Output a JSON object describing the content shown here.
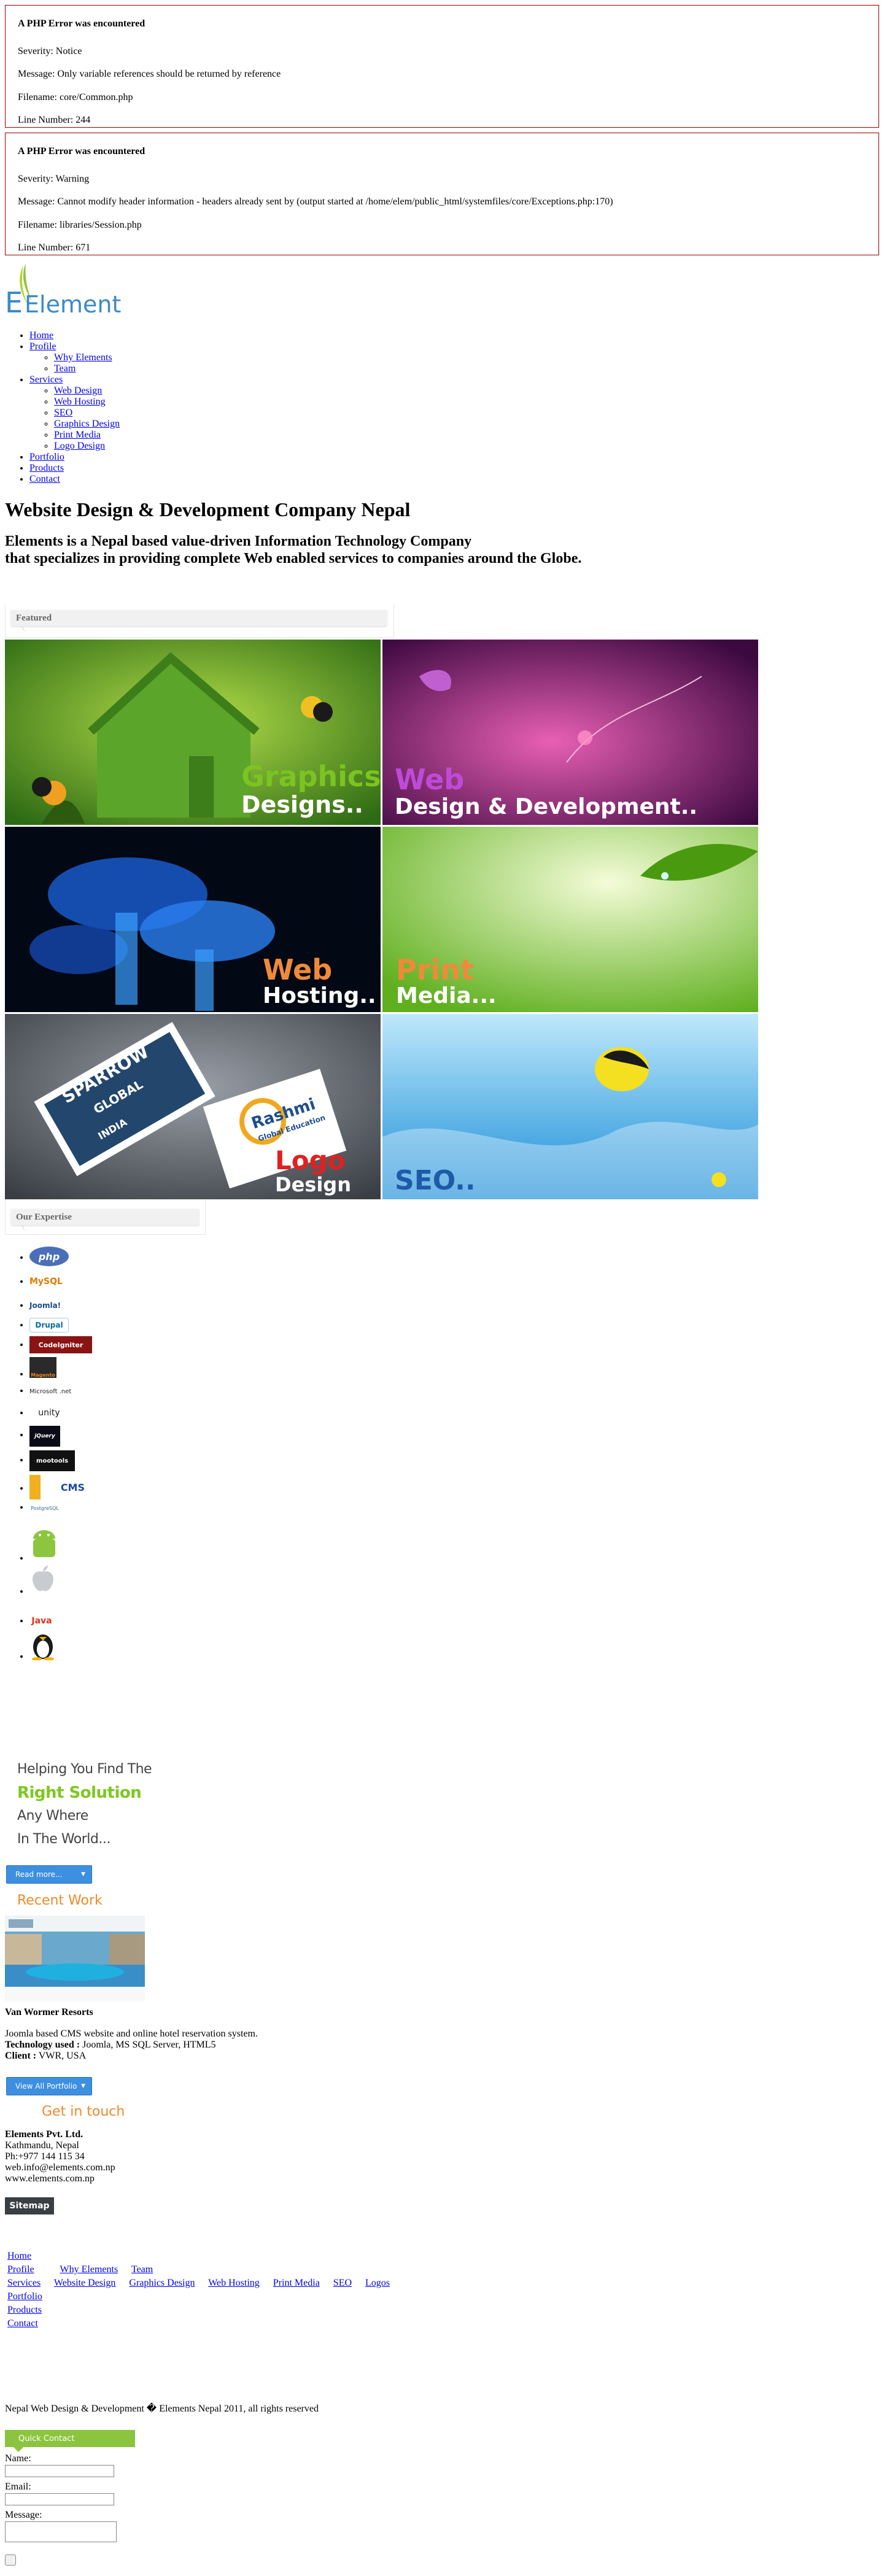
{
  "errors": [
    {
      "heading": "A PHP Error was encountered",
      "severity": "Severity: Notice",
      "message": "Message: Only variable references should be returned by reference",
      "filename": "Filename: core/Common.php",
      "line": "Line Number: 244"
    },
    {
      "heading": "A PHP Error was encountered",
      "severity": "Severity: Warning",
      "message": "Message: Cannot modify header information - headers already sent by (output started at /home/elem/public_html/systemfiles/core/Exceptions.php:170)",
      "filename": "Filename: libraries/Session.php",
      "line": "Line Number: 671"
    }
  ],
  "logo": {
    "text": "Elements",
    "color": "#2a7fbf",
    "accent": "#8cc63f"
  },
  "nav": {
    "home": "Home",
    "profile": "Profile",
    "profile_sub": [
      "Why Elements",
      "Team"
    ],
    "services": "Services",
    "services_sub": [
      "Web Design",
      "Web Hosting",
      "SEO",
      "Graphics Design",
      "Print Media",
      "Logo Design"
    ],
    "portfolio": "Portfolio",
    "products": "Products",
    "contact": "Contact"
  },
  "headline": "Website Design & Development Company Nepal",
  "tagline_1": "Elements is a Nepal based value-driven Information Technology Company",
  "tagline_2": "that specializes in providing complete Web enabled services to companies around the Globe.",
  "featured": {
    "title": "Featured",
    "tiles": [
      {
        "line1": "Graphics",
        "line2": "Designs.."
      },
      {
        "line1": "Web",
        "line2": "Design & Development.."
      },
      {
        "line1": "Web",
        "line2": "Hosting.."
      },
      {
        "line1": "Print",
        "line2": "Media..."
      },
      {
        "brand1": "SPARROW",
        "brand2": "GLOBAL",
        "brand3": "INDIA",
        "brand4": "Rashmi",
        "brand5": "Global Education",
        "line1": "Logo",
        "line2": "Design"
      },
      {
        "line1": "SEO.."
      }
    ]
  },
  "expertise": {
    "title": "Our Expertise",
    "items": [
      "php",
      "MySQL",
      "Joomla!",
      "Drupal",
      "CodeIgniter",
      "Magento",
      "Microsoft .net",
      "unity",
      "jQuery",
      "mootools",
      "CMS",
      "PostgreSQL",
      "",
      "",
      "",
      "Java",
      ""
    ]
  },
  "promo": {
    "line1": "Helping You Find The",
    "line2": "Right Solution",
    "line3": "Any Where",
    "line4": "In The World...",
    "read_more": "Read more..."
  },
  "recent": {
    "heading": "Recent Work",
    "project_title": "Van Wormer Resorts",
    "description": "Joomla based CMS website and online hotel reservation system.",
    "tech_label": "Technology used :",
    "tech_value": " Joomla, MS SQL Server, HTML5",
    "client_label": "Client :",
    "client_value": " VWR, USA",
    "view_all": "View All Portfolio"
  },
  "contact": {
    "heading": "Get in touch",
    "company": "Elements Pvt. Ltd.",
    "city": "Kathmandu, Nepal",
    "phone": "Ph:+977 144 115 34",
    "email": "web.info@elements.com.np",
    "web": "www.elements.com.np"
  },
  "sitemap": {
    "button": "Sitemap",
    "home": "Home",
    "profile": "Profile",
    "why": "Why Elements",
    "team": "Team",
    "services": "Services",
    "web_design": "Website Design",
    "graphics": "Graphics Design",
    "hosting": "Web Hosting",
    "print": "Print Media",
    "seo": "SEO",
    "logos": "Logos",
    "portfolio": "Portfolio",
    "products": "Products",
    "contact": "Contact"
  },
  "copyright": "Nepal Web Design & Development � Elements Nepal 2011, all rights reserved",
  "quick_contact": {
    "title": "Quick Contact",
    "name_label": "Name:",
    "email_label": "Email:",
    "message_label": "Message:"
  }
}
